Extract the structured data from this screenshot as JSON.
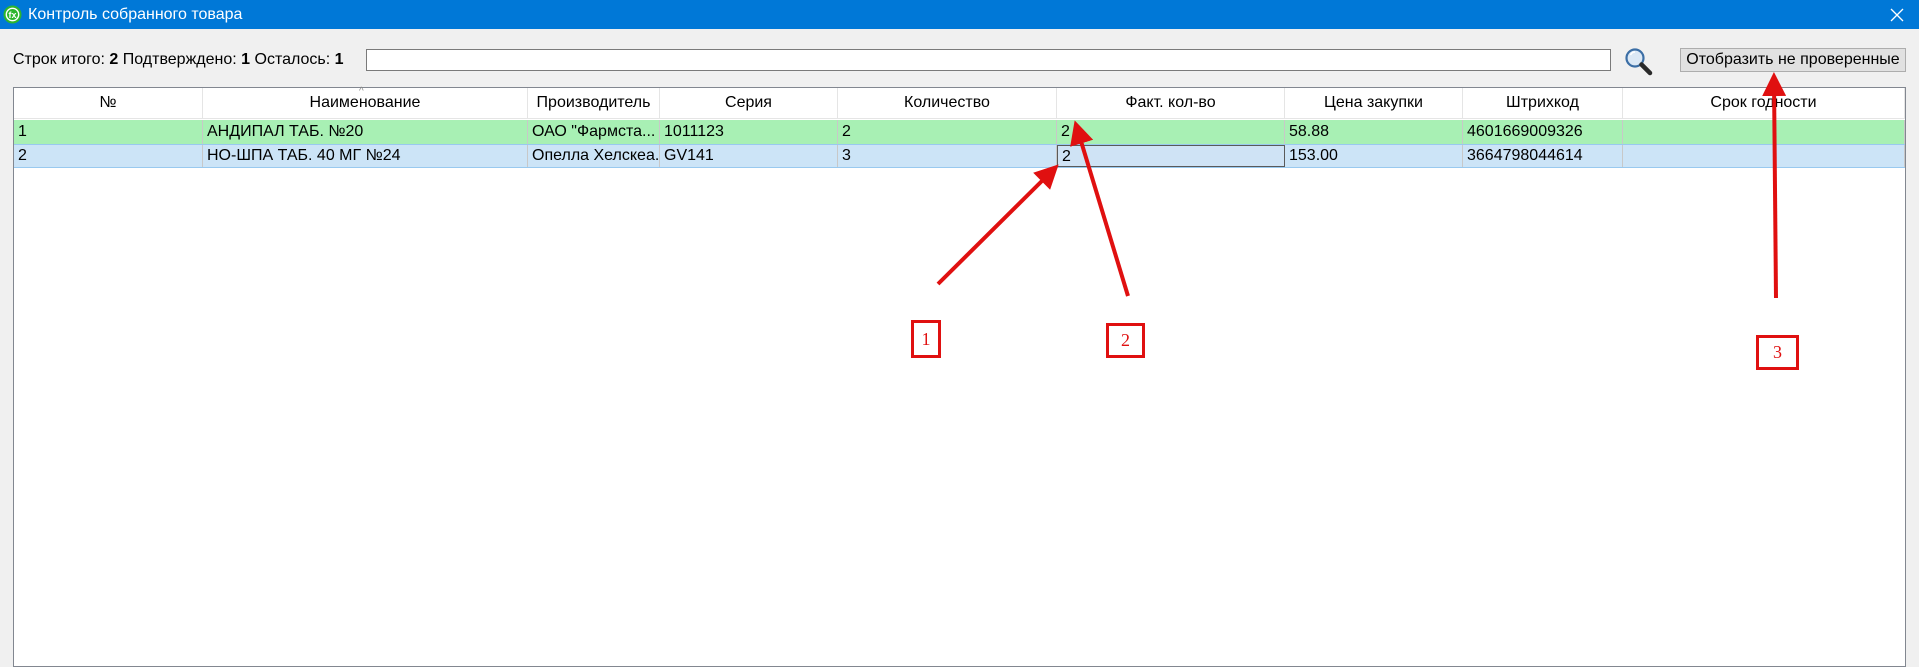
{
  "window": {
    "title": "Контроль собранного товара",
    "close_icon": "close-icon"
  },
  "toolbar": {
    "rows_total_label": "Строк итого:",
    "rows_total": "2",
    "confirmed_label": "Подтверждено:",
    "confirmed": "1",
    "remaining_label": "Осталось:",
    "remaining": "1",
    "search_value": "",
    "search_icon": "search-icon",
    "show_unchecked_label": "Отобразить не проверенные"
  },
  "table": {
    "columns": [
      "№",
      "Наименование",
      "Производитель",
      "Серия",
      "Количество",
      "Факт. кол-во",
      "Цена закупки",
      "Штрихкод",
      "Срок годности"
    ],
    "rows": [
      {
        "num": "1",
        "name": "АНДИПАЛ ТАБ. №20",
        "maker": "ОАО \"Фармста...",
        "series": "1011123",
        "qty": "2",
        "fact_qty": "2",
        "price": "58.88",
        "barcode": "4601669009326",
        "expiry": ""
      },
      {
        "num": "2",
        "name": "НО-ШПА ТАБ. 40 МГ №24",
        "maker": "Опелла Хелскеа...",
        "series": "GV141",
        "qty": "3",
        "fact_qty": "2",
        "price": "153.00",
        "barcode": "3664798044614",
        "expiry": ""
      }
    ],
    "row_colors": {
      "confirmed": "#a8f0b4",
      "selected": "#cce4f7"
    }
  },
  "annotations": {
    "marker_1": "1",
    "marker_2": "2",
    "marker_3": "3",
    "color": "#e01010"
  }
}
